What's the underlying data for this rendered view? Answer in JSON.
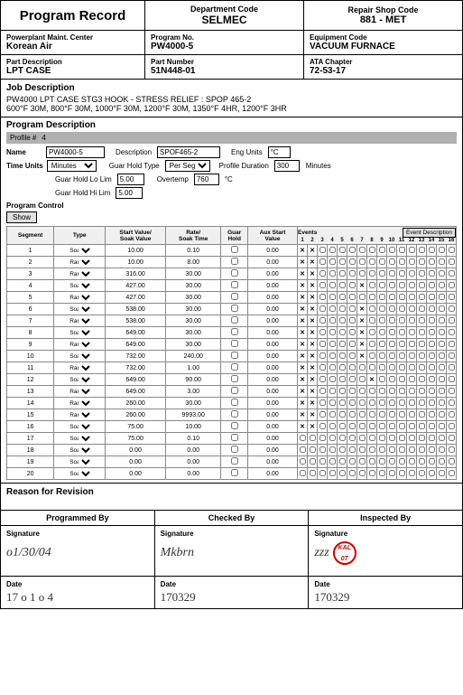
{
  "header": {
    "title": "Program Record",
    "dept_label": "Department Code",
    "dept_value": "SELMEC",
    "shop_label": "Repair Shop Code",
    "shop_value": "881 - MET"
  },
  "info": {
    "plant_label": "Powerplant Maint. Center",
    "plant_value": "Korean Air",
    "program_label": "Program No.",
    "program_value": "PW4000-5",
    "equipment_label": "Equipment Code",
    "equipment_value": "VACUUM FURNACE"
  },
  "part": {
    "desc_label": "Part Description",
    "desc_value": "LPT CASE",
    "number_label": "Part Number",
    "number_value": "51N448-01",
    "ata_label": "ATA Chapter",
    "ata_value": "72-53-17"
  },
  "job": {
    "title": "Job Description",
    "line1": "PW4000 LPT CASE STG3 HOOK - STRESS RELIEF : SPOP 465-2",
    "line2": "600°F 30M, 800°F 30M, 1000°F 30M, 1200°F 30M, 1350°F 4HR, 1200°F 3HR"
  },
  "program_desc": {
    "title": "Program Description",
    "profile_label": "Profile #",
    "profile_value": "4",
    "name_label": "Name",
    "name_value": "PW4000-5",
    "desc_field_label": "Description",
    "desc_field_value": "SPOF465-2",
    "eng_units_label": "Eng Units",
    "eng_units_value": "°C",
    "time_units_label": "Time Units",
    "time_units_value": "Minutes",
    "time_units_select": "Minutes",
    "hold_type_label": "Guar Hold Type",
    "hold_type_value": "Per Seg",
    "profile_dur_label": "Profile Duration",
    "profile_dur_value": "300",
    "minutes_label": "Minutes",
    "overtemp_label": "Overtemp",
    "overtemp_value": "760",
    "tc_unit": "°C",
    "guar_hold_lo_label": "Guar Hold Lo Lim",
    "guar_hold_lo_value": "5.00",
    "guar_hold_hi_label": "Guar Hold Hi Lim",
    "guar_hold_hi_value": "5.00",
    "prog_control_title": "Program Control",
    "show_btn_label": "Show"
  },
  "segments": [
    {
      "num": 1,
      "type": "Soak",
      "start": "10.00",
      "rate": "0.10",
      "hold": false,
      "aux": "0.00",
      "events": [
        true,
        true,
        false,
        false,
        false,
        false,
        false,
        false,
        false,
        false,
        false,
        false,
        false,
        false,
        false,
        false
      ]
    },
    {
      "num": 2,
      "type": "Ramp",
      "start": "10.00",
      "rate": "8.00",
      "hold": false,
      "aux": "0.00",
      "events": [
        true,
        true,
        false,
        false,
        false,
        false,
        false,
        false,
        false,
        false,
        false,
        false,
        false,
        false,
        false,
        false
      ]
    },
    {
      "num": 3,
      "type": "Ramp",
      "start": "316.00",
      "rate": "30.00",
      "hold": false,
      "aux": "0.00",
      "events": [
        true,
        true,
        false,
        false,
        false,
        false,
        false,
        false,
        false,
        false,
        false,
        false,
        false,
        false,
        false,
        false
      ]
    },
    {
      "num": 4,
      "type": "Soak",
      "start": "427.00",
      "rate": "30.00",
      "hold": false,
      "aux": "0.00",
      "events": [
        true,
        true,
        false,
        false,
        false,
        false,
        true,
        false,
        false,
        false,
        false,
        false,
        false,
        false,
        false,
        false
      ]
    },
    {
      "num": 5,
      "type": "Ramp",
      "start": "427.00",
      "rate": "30.00",
      "hold": false,
      "aux": "0.00",
      "events": [
        true,
        true,
        false,
        false,
        false,
        false,
        false,
        false,
        false,
        false,
        false,
        false,
        false,
        false,
        false,
        false
      ]
    },
    {
      "num": 6,
      "type": "Soak",
      "start": "538.00",
      "rate": "30.00",
      "hold": false,
      "aux": "0.00",
      "events": [
        true,
        true,
        false,
        false,
        false,
        false,
        true,
        false,
        false,
        false,
        false,
        false,
        false,
        false,
        false,
        false
      ]
    },
    {
      "num": 7,
      "type": "Ramp",
      "start": "538.00",
      "rate": "30.00",
      "hold": false,
      "aux": "0.00",
      "events": [
        true,
        true,
        false,
        false,
        false,
        false,
        true,
        false,
        false,
        false,
        false,
        false,
        false,
        false,
        false,
        false
      ]
    },
    {
      "num": 8,
      "type": "Soak",
      "start": "649.00",
      "rate": "30.00",
      "hold": false,
      "aux": "0.00",
      "events": [
        true,
        true,
        false,
        false,
        false,
        false,
        true,
        false,
        false,
        false,
        false,
        false,
        false,
        false,
        false,
        false
      ]
    },
    {
      "num": 9,
      "type": "Ramp",
      "start": "649.00",
      "rate": "30.00",
      "hold": false,
      "aux": "0.00",
      "events": [
        true,
        true,
        false,
        false,
        false,
        false,
        true,
        false,
        false,
        false,
        false,
        false,
        false,
        false,
        false,
        false
      ]
    },
    {
      "num": 10,
      "type": "Soak",
      "start": "732.00",
      "rate": "240.00",
      "hold": false,
      "aux": "0.00",
      "events": [
        true,
        true,
        false,
        false,
        false,
        false,
        true,
        false,
        false,
        false,
        false,
        false,
        false,
        false,
        false,
        false
      ]
    },
    {
      "num": 11,
      "type": "Ramp",
      "start": "732.00",
      "rate": "1.00",
      "hold": false,
      "aux": "0.00",
      "events": [
        true,
        true,
        false,
        false,
        false,
        false,
        false,
        false,
        false,
        false,
        false,
        false,
        false,
        false,
        false,
        false
      ]
    },
    {
      "num": 12,
      "type": "Soak",
      "start": "649.00",
      "rate": "90.00",
      "hold": false,
      "aux": "0.00",
      "events": [
        true,
        true,
        false,
        false,
        false,
        false,
        false,
        true,
        false,
        false,
        false,
        false,
        false,
        false,
        false,
        false
      ]
    },
    {
      "num": 13,
      "type": "Ramp",
      "start": "649.00",
      "rate": "3.00",
      "hold": false,
      "aux": "0.00",
      "events": [
        true,
        true,
        false,
        false,
        false,
        false,
        false,
        false,
        false,
        false,
        false,
        false,
        false,
        false,
        false,
        false
      ]
    },
    {
      "num": 14,
      "type": "Ramp",
      "start": "260.00",
      "rate": "30.00",
      "hold": false,
      "aux": "0.00",
      "events": [
        true,
        true,
        false,
        false,
        false,
        false,
        false,
        false,
        false,
        false,
        false,
        false,
        false,
        false,
        false,
        false
      ]
    },
    {
      "num": 15,
      "type": "Ramp",
      "start": "260.00",
      "rate": "9993.00",
      "hold": false,
      "aux": "0.00",
      "events": [
        true,
        true,
        false,
        false,
        false,
        false,
        false,
        false,
        false,
        false,
        false,
        false,
        false,
        false,
        false,
        false
      ]
    },
    {
      "num": 16,
      "type": "Soak",
      "start": "75.00",
      "rate": "10.00",
      "hold": false,
      "aux": "0.00",
      "events": [
        true,
        true,
        false,
        false,
        false,
        false,
        false,
        false,
        false,
        false,
        false,
        false,
        false,
        false,
        false,
        false
      ]
    },
    {
      "num": 17,
      "type": "Soak",
      "start": "75.00",
      "rate": "0.10",
      "hold": false,
      "aux": "0.00",
      "events": [
        false,
        false,
        false,
        false,
        false,
        false,
        false,
        false,
        false,
        false,
        false,
        false,
        false,
        false,
        false,
        false
      ]
    },
    {
      "num": 18,
      "type": "Soak",
      "start": "0.00",
      "rate": "0.00",
      "hold": false,
      "aux": "0.00",
      "events": [
        false,
        false,
        false,
        false,
        false,
        false,
        false,
        false,
        false,
        false,
        false,
        false,
        false,
        false,
        false,
        false
      ]
    },
    {
      "num": 19,
      "type": "Soak",
      "start": "0.00",
      "rate": "0.00",
      "hold": false,
      "aux": "0.00",
      "events": [
        false,
        false,
        false,
        false,
        false,
        false,
        false,
        false,
        false,
        false,
        false,
        false,
        false,
        false,
        false,
        false
      ]
    },
    {
      "num": 20,
      "type": "Soak",
      "start": "0.00",
      "rate": "0.00",
      "hold": false,
      "aux": "0.00",
      "events": [
        false,
        false,
        false,
        false,
        false,
        false,
        false,
        false,
        false,
        false,
        false,
        false,
        false,
        false,
        false,
        false
      ]
    }
  ],
  "event_desc_btn": "Event Description",
  "reason": {
    "title": "Reason for Revision"
  },
  "signatures": {
    "programmed_by": "Programmed By",
    "checked_by": "Checked By",
    "inspected_by": "Inspected By",
    "sig_label": "Signature",
    "date_label": "Date",
    "date1": "17 o 1 o 4",
    "date2": "170329",
    "date3": "170329",
    "stamp_line1": "KAL",
    "stamp_line2": "07"
  }
}
